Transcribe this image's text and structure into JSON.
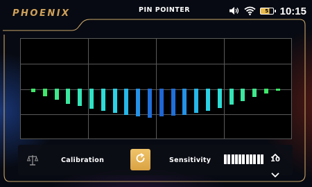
{
  "header": {
    "logo": "PHOENIX",
    "title": "PIN POINTER",
    "time": "10:15",
    "battery_level": "5"
  },
  "icons": {
    "volume": "volume-icon",
    "wifi": "wifi-icon",
    "battery": "battery-icon",
    "scale": "scale-icon",
    "refresh": "refresh-icon"
  },
  "colors": {
    "accent_gold": "#cfa15a",
    "button_gold": "#e2ad4f",
    "bar_green": "#3ee87a",
    "bar_cyan": "#2fd8e6",
    "bar_blue": "#1f6fd9"
  },
  "signal_bars": [
    {
      "value": 0.15,
      "color": "#3ee86a"
    },
    {
      "value": 0.35,
      "color": "#3ee86a"
    },
    {
      "value": 0.5,
      "color": "#3ee88a"
    },
    {
      "value": 0.68,
      "color": "#3ae89e"
    },
    {
      "value": 0.78,
      "color": "#35e4b6"
    },
    {
      "value": 0.92,
      "color": "#2fe2c6"
    },
    {
      "value": 1.0,
      "color": "#2ddbd6"
    },
    {
      "value": 1.1,
      "color": "#2bd2e6"
    },
    {
      "value": 1.18,
      "color": "#27b6e8"
    },
    {
      "value": 1.25,
      "color": "#2492e6"
    },
    {
      "value": 1.3,
      "color": "#1f6fd9"
    },
    {
      "value": 1.25,
      "color": "#1f66d6"
    },
    {
      "value": 1.22,
      "color": "#1f6fd9"
    },
    {
      "value": 1.18,
      "color": "#2492e6"
    },
    {
      "value": 1.1,
      "color": "#27b6e8"
    },
    {
      "value": 1.0,
      "color": "#2bd2e6"
    },
    {
      "value": 0.88,
      "color": "#2ddbd6"
    },
    {
      "value": 0.72,
      "color": "#35e4b6"
    },
    {
      "value": 0.55,
      "color": "#3ae89e"
    },
    {
      "value": 0.38,
      "color": "#3ee88a"
    },
    {
      "value": 0.22,
      "color": "#3ee86a"
    },
    {
      "value": 0.08,
      "color": "#3ee86a"
    }
  ],
  "controls": {
    "calibration_label": "Calibration",
    "sensitivity_label": "Sensitivity",
    "sensitivity_value": "10",
    "sensitivity_segments": 11,
    "sensitivity_filled": 11
  }
}
